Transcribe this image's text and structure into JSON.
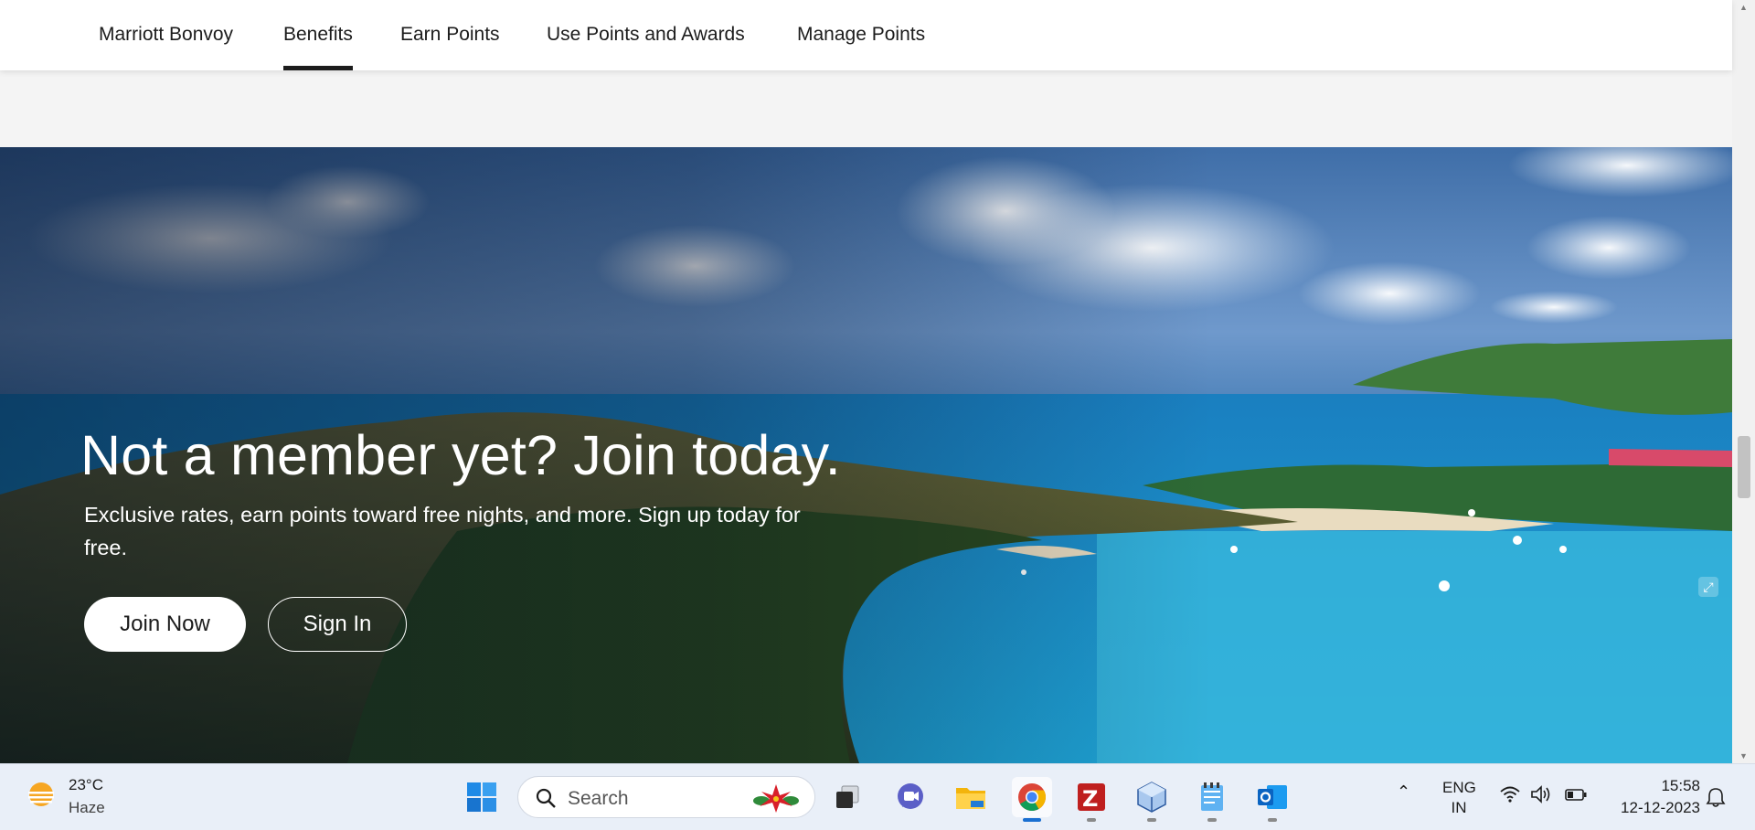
{
  "nav": {
    "tabs": [
      {
        "label": "Marriott Bonvoy"
      },
      {
        "label": "Benefits",
        "active": true
      },
      {
        "label": "Earn Points"
      },
      {
        "label": "Use Points and Awards"
      },
      {
        "label": "Manage Points"
      }
    ]
  },
  "hero": {
    "title": "Not a member yet? Join today.",
    "subtitle": "Exclusive rates, earn points toward free nights, and more. Sign up today for free.",
    "join_label": "Join Now",
    "signin_label": "Sign In"
  },
  "taskbar": {
    "weather": {
      "temp": "23°C",
      "condition": "Haze",
      "icon": "sun-haze-icon"
    },
    "search_label": "Search",
    "apps": [
      "windows-start-icon",
      "task-view-icon",
      "chat-icon",
      "file-explorer-icon",
      "chrome-icon",
      "filezilla-icon",
      "virtualbox-icon",
      "notepad-icon",
      "outlook-icon"
    ],
    "active_app": "chrome-icon",
    "language": {
      "line1": "ENG",
      "line2": "IN"
    },
    "time": "15:58",
    "date": "12-12-2023"
  },
  "colors": {
    "nav_active_underline": "#1c1c1c",
    "taskbar_bg": "#e9eff8",
    "active_indicator": "#1a6fd1"
  }
}
